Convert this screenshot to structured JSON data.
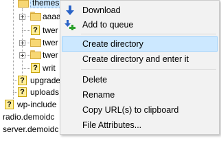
{
  "tree": {
    "items": [
      {
        "label": "themes"
      },
      {
        "label": "aaaa"
      },
      {
        "label": "twer"
      },
      {
        "label": "twer"
      },
      {
        "label": "twer"
      },
      {
        "label": "writ"
      },
      {
        "label": "upgrade"
      },
      {
        "label": "uploads"
      },
      {
        "label": "wp-include"
      },
      {
        "label": "radio.demoidc"
      },
      {
        "label": "server.demoidc"
      }
    ]
  },
  "context_menu": {
    "items": [
      {
        "label": "Download",
        "icon": "download-arrow-icon"
      },
      {
        "label": "Add to queue",
        "icon": "add-to-queue-icon"
      },
      {
        "label": "Create directory"
      },
      {
        "label": "Create directory and enter it"
      },
      {
        "label": "Delete"
      },
      {
        "label": "Rename"
      },
      {
        "label": "Copy URL(s) to clipboard"
      },
      {
        "label": "File Attributes..."
      }
    ],
    "highlighted": "Create directory",
    "colors": {
      "download_arrow": "#2a63c7",
      "queue_plus": "#2aa02a",
      "highlight": "#cce8ff"
    }
  }
}
